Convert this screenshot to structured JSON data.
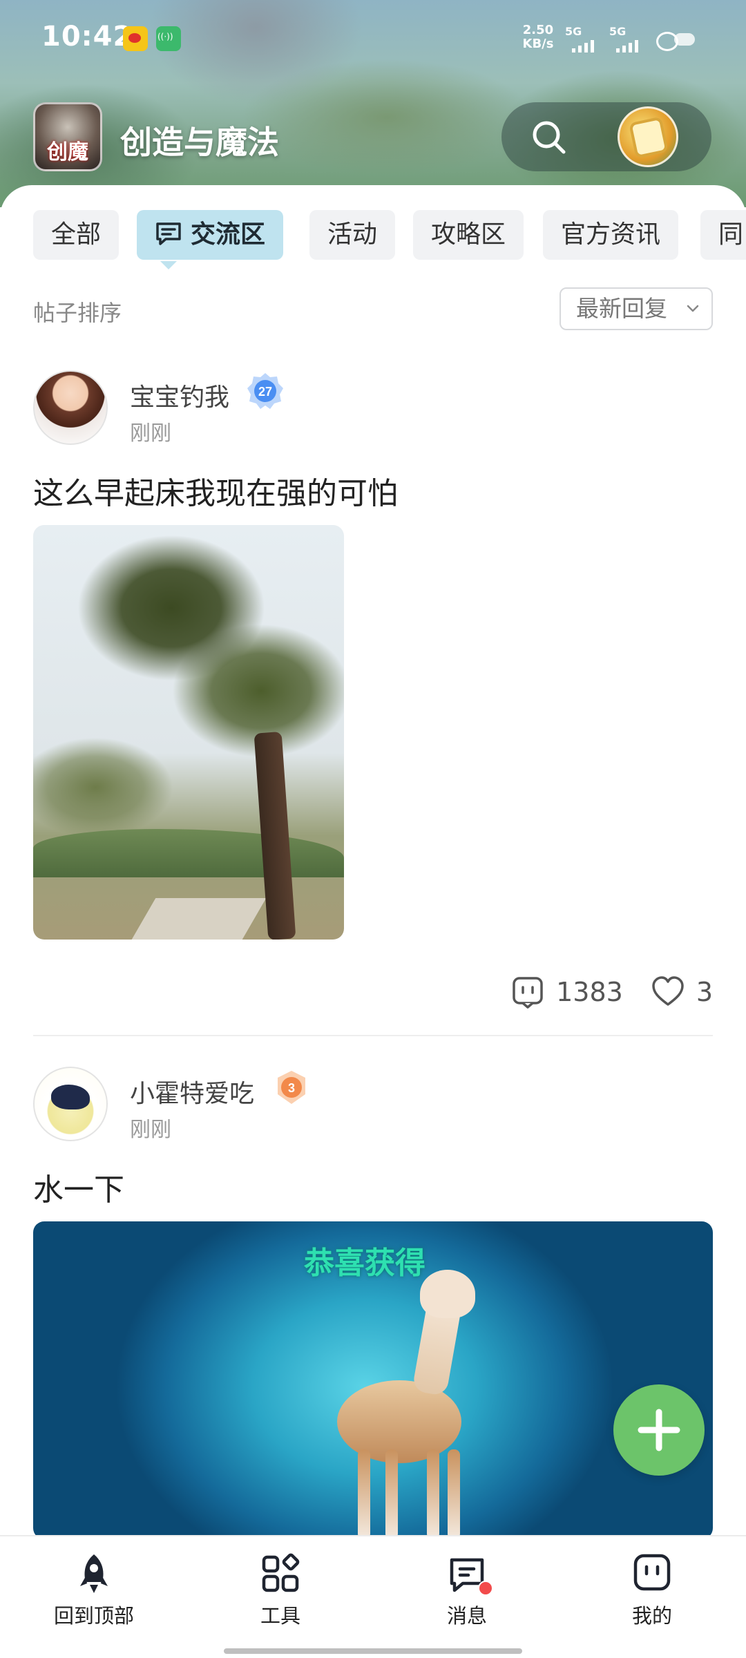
{
  "status_bar": {
    "time": "10:42",
    "net_speed_value": "2.50",
    "net_speed_unit": "KB/s",
    "signal_1_label": "5G",
    "signal_2_label": "5G",
    "icons": [
      "weibo-icon",
      "hotspot-icon",
      "signal-icon",
      "battery-icon"
    ]
  },
  "header": {
    "logo_text": "创魔",
    "title": "创造与魔法"
  },
  "tabs": [
    {
      "label": "全部",
      "active": false
    },
    {
      "label": "交流区",
      "active": true
    },
    {
      "label": "活动",
      "active": false
    },
    {
      "label": "攻略区",
      "active": false
    },
    {
      "label": "官方资讯",
      "active": false
    },
    {
      "label": "同",
      "active": false
    }
  ],
  "sort": {
    "label": "帖子排序",
    "selected": "最新回复"
  },
  "posts": [
    {
      "username": "宝宝钓我",
      "level": "27",
      "time": "刚刚",
      "text": "这么早起床我现在强的可怕",
      "comments": "1383",
      "likes": "3"
    },
    {
      "username": "小霍特爱吃",
      "level": "3",
      "time": "刚刚",
      "text": "水一下",
      "image_text": "恭喜获得"
    }
  ],
  "bottom_nav": [
    {
      "label": "回到顶部",
      "icon": "rocket-icon"
    },
    {
      "label": "工具",
      "icon": "tools-grid-icon"
    },
    {
      "label": "消息",
      "icon": "message-icon"
    },
    {
      "label": "我的",
      "icon": "profile-icon"
    }
  ],
  "colors": {
    "active_tab_bg": "#bfe3ef",
    "fab": "#6cc46a",
    "badge_blue": "#4a8ef2",
    "badge_orange": "#f2894a",
    "notification_dot": "#f24b4b"
  }
}
